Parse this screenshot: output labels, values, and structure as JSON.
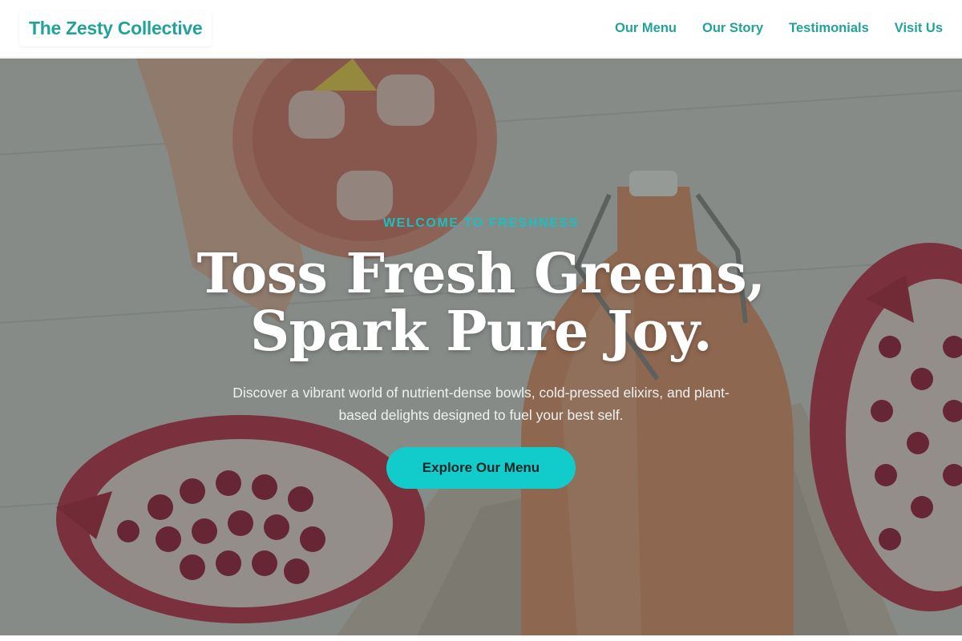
{
  "header": {
    "logo_text": "The Zesty Collective",
    "nav": [
      {
        "label": "Our Menu"
      },
      {
        "label": "Our Story"
      },
      {
        "label": "Testimonials"
      },
      {
        "label": "Visit Us"
      }
    ]
  },
  "hero": {
    "eyebrow": "WELCOME TO FRESHNESS",
    "headline_line1": "Toss Fresh Greens,",
    "headline_line2": "Spark Pure Joy.",
    "subtext": "Discover a vibrant world of nutrient-dense bowls, cold-pressed elixirs, and plant-based delights designed to fuel your best self.",
    "cta_label": "Explore Our Menu",
    "background_image": "iced pink drink, swing-top bottle and pomegranates on a white wood table"
  },
  "colors": {
    "brand_teal": "#22a39a",
    "accent_cyan": "#12cccc",
    "eyebrow_teal": "#19c0bf",
    "headline_white": "#ffffff"
  }
}
